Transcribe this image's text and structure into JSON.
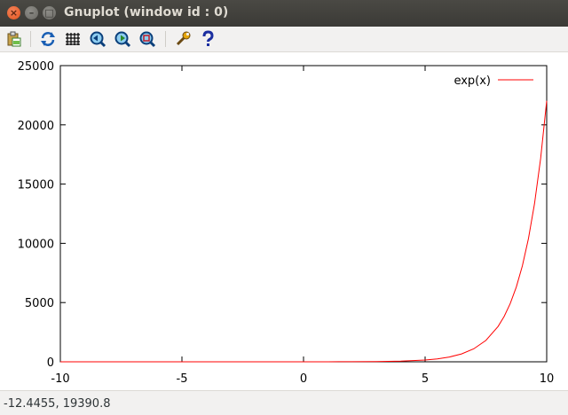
{
  "window": {
    "title": "Gnuplot (window id : 0)",
    "close_glyph": "×",
    "minimize_glyph": "–",
    "maximize_glyph": "□"
  },
  "toolbar": {
    "buttons": [
      {
        "name": "copy-to-clipboard",
        "icon": "clipboard-icon"
      },
      {
        "name": "replot",
        "icon": "replot-arrows-icon"
      },
      {
        "name": "grid",
        "icon": "grid-icon"
      },
      {
        "name": "zoom-previous",
        "icon": "zoom-previous-icon"
      },
      {
        "name": "zoom-next",
        "icon": "zoom-next-icon"
      },
      {
        "name": "autoscale",
        "icon": "zoom-autoscale-icon"
      },
      {
        "name": "options",
        "icon": "wrench-icon"
      },
      {
        "name": "help",
        "icon": "help-icon"
      }
    ]
  },
  "chart_data": {
    "type": "line",
    "title": "",
    "xlabel": "",
    "ylabel": "",
    "xlim": [
      -10,
      10
    ],
    "ylim": [
      0,
      25000
    ],
    "xticks": [
      -10,
      -5,
      0,
      5,
      10
    ],
    "xtick_labels": [
      "-10",
      "-5",
      "0",
      "5",
      "10"
    ],
    "yticks": [
      0,
      5000,
      10000,
      15000,
      20000,
      25000
    ],
    "ytick_labels": [
      "0",
      "5000",
      "10000",
      "15000",
      "20000",
      "25000"
    ],
    "grid": false,
    "legend": "top-right",
    "series": [
      {
        "name": "exp(x)",
        "color": "#ff0000",
        "x": [
          -10,
          -8,
          -6,
          -4,
          -2,
          0,
          1,
          2,
          3,
          4,
          5,
          5.5,
          6,
          6.5,
          7,
          7.5,
          8,
          8.25,
          8.5,
          8.75,
          9,
          9.25,
          9.5,
          9.75,
          10
        ],
        "y": [
          4.54e-05,
          0.000335,
          0.00248,
          0.0183,
          0.135,
          1,
          2.718,
          7.389,
          20.09,
          54.6,
          148.4,
          244.7,
          403.4,
          665.1,
          1096.6,
          1808.0,
          2981.0,
          3827.6,
          4914.8,
          6310.7,
          8103.1,
          10404.6,
          13359.7,
          17154.2,
          22026.5
        ]
      }
    ]
  },
  "status": {
    "coordinates": "-12.4455,  19390.8"
  }
}
